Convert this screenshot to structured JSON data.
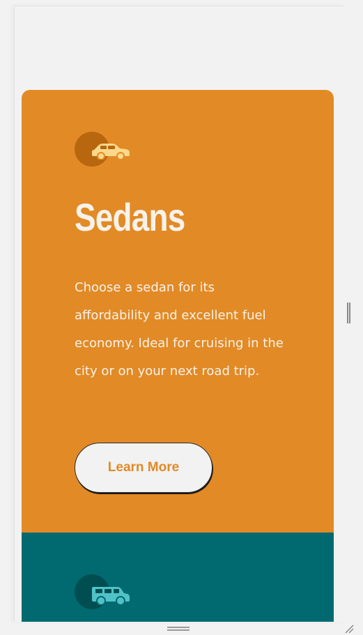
{
  "cards": [
    {
      "title": "Sedans",
      "description": "Choose a sedan for its affordability and excellent fuel economy. Ideal for cruising in the city or on your next road trip.",
      "button_label": "Learn More",
      "icon": "sedan-car-icon",
      "color": "#e28a26"
    },
    {
      "icon": "suv-car-icon",
      "color": "#006a70"
    }
  ],
  "colors": {
    "page_background": "#f2f2f3",
    "button_background": "#f2f2f3",
    "text_light": "#f7f2ea"
  }
}
